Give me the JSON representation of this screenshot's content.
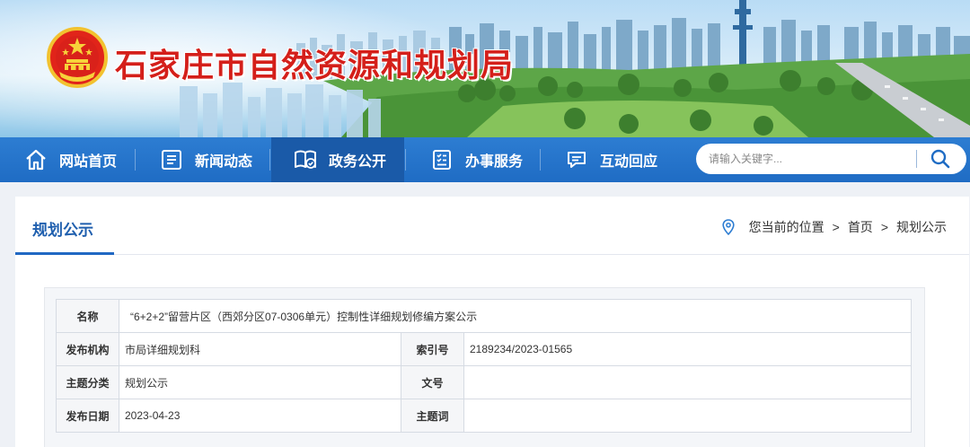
{
  "header": {
    "site_title": "石家庄市自然资源和规划局",
    "colors": {
      "title_red": "#d41f1a",
      "nav_blue": "#1f6cc4"
    }
  },
  "nav": {
    "items": [
      {
        "label": "网站首页",
        "icon": "home-icon"
      },
      {
        "label": "新闻动态",
        "icon": "news-icon"
      },
      {
        "label": "政务公开",
        "icon": "gov-affairs-icon",
        "active": true
      },
      {
        "label": "办事服务",
        "icon": "service-icon"
      },
      {
        "label": "互动回应",
        "icon": "chat-icon"
      }
    ]
  },
  "search": {
    "placeholder": "请输入关键字...",
    "icon": "search-icon"
  },
  "section": {
    "title": "规划公示"
  },
  "breadcrumb": {
    "prefix": "您当前的位置",
    "separator": ">",
    "items": [
      "首页",
      "规划公示"
    ]
  },
  "meta": {
    "name_label": "名称",
    "name_value": "“6+2+2”留营片区（西郊分区07-0306单元）控制性详细规划修编方案公示",
    "publisher_label": "发布机构",
    "publisher_value": "市局详细规划科",
    "index_label": "索引号",
    "index_value": "2189234/2023-01565",
    "category_label": "主题分类",
    "category_value": "规划公示",
    "docno_label": "文号",
    "docno_value": "",
    "date_label": "发布日期",
    "date_value": "2023-04-23",
    "keywords_label": "主题词",
    "keywords_value": ""
  }
}
